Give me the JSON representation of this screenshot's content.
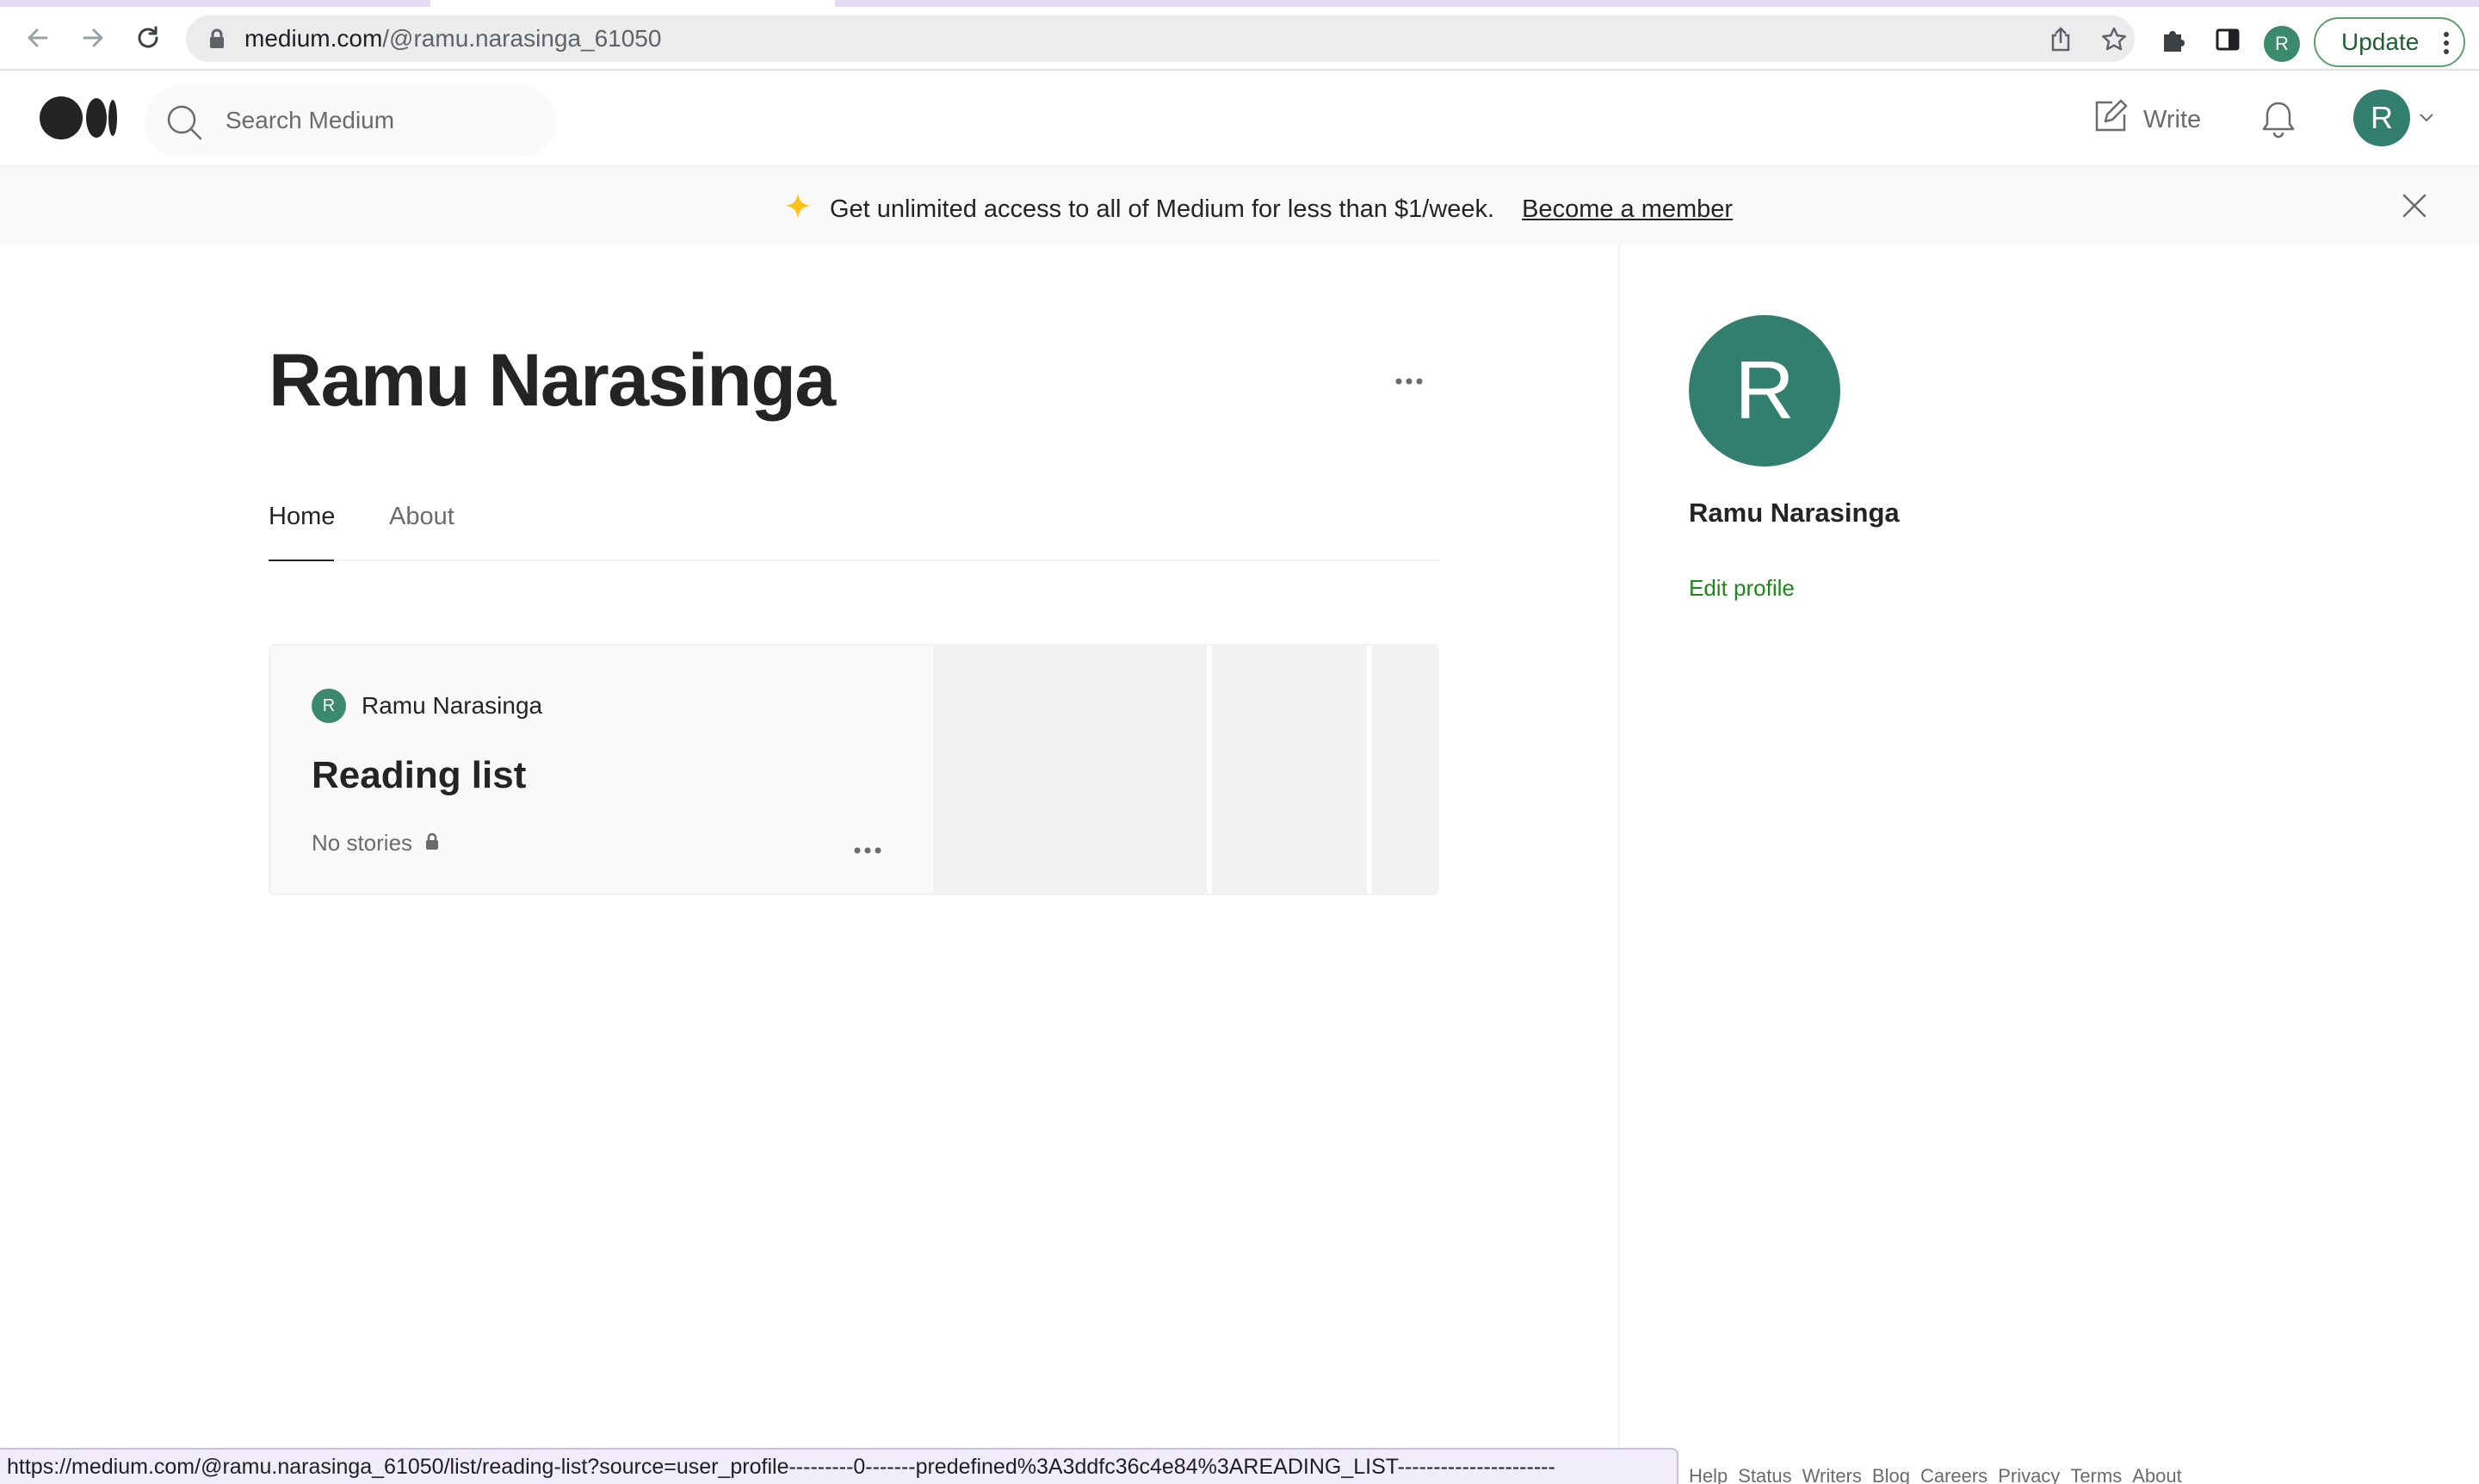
{
  "browser": {
    "url_host": "medium.com",
    "url_path": "/@ramu.narasinga_61050",
    "profile_initial": "R",
    "update_label": "Update",
    "status_url": "https://medium.com/@ramu.narasinga_61050/list/reading-list?source=user_profile---------0-------predefined%3A3ddfc36c4e84%3AREADING_LIST----------------------"
  },
  "header": {
    "search_placeholder": "Search Medium",
    "write_label": "Write",
    "avatar_initial": "R"
  },
  "promo": {
    "text": "Get unlimited access to all of Medium for less than $1/week.",
    "link_label": "Become a member"
  },
  "profile": {
    "name": "Ramu Narasinga",
    "tabs": [
      {
        "label": "Home",
        "active": true
      },
      {
        "label": "About",
        "active": false
      }
    ]
  },
  "reading_list_card": {
    "author_initial": "R",
    "author_name": "Ramu Narasinga",
    "title": "Reading list",
    "meta": "No stories"
  },
  "sidebar": {
    "avatar_initial": "R",
    "name": "Ramu Narasinga",
    "edit_label": "Edit profile",
    "footer_links": [
      "Help",
      "Status",
      "Writers",
      "Blog",
      "Careers",
      "Privacy",
      "Terms",
      "About"
    ]
  },
  "colors": {
    "avatar": "#327f6f",
    "edit_link": "#1a8917",
    "promo_bg": "#f9f9f9",
    "star": "#ffc017"
  }
}
